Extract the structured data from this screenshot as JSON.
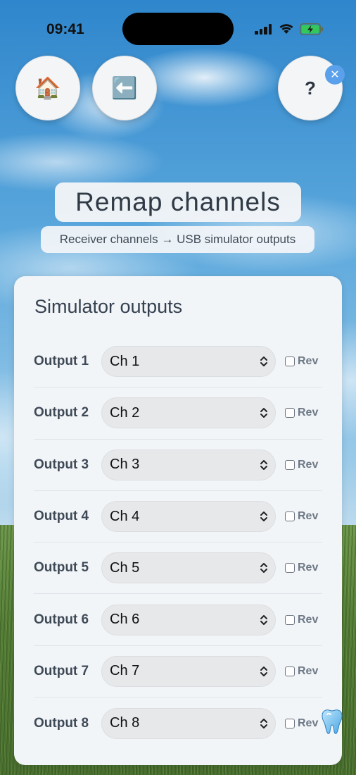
{
  "status_bar": {
    "time": "09:41"
  },
  "nav": {
    "home_icon": "🏠",
    "back_icon": "⬅️",
    "help_label": "?",
    "close_label": "✕"
  },
  "header": {
    "title": "Remap channels",
    "subtitle": "Receiver channels → USB simulator outputs"
  },
  "card": {
    "title": "Simulator outputs",
    "rev_label": "Rev",
    "rows": [
      {
        "label": "Output 1",
        "channel": "Ch 1",
        "reversed": false
      },
      {
        "label": "Output 2",
        "channel": "Ch 2",
        "reversed": false
      },
      {
        "label": "Output 3",
        "channel": "Ch 3",
        "reversed": false
      },
      {
        "label": "Output 4",
        "channel": "Ch 4",
        "reversed": false
      },
      {
        "label": "Output 5",
        "channel": "Ch 5",
        "reversed": false
      },
      {
        "label": "Output 6",
        "channel": "Ch 6",
        "reversed": false
      },
      {
        "label": "Output 7",
        "channel": "Ch 7",
        "reversed": false
      },
      {
        "label": "Output 8",
        "channel": "Ch 8",
        "reversed": false
      }
    ]
  },
  "colors": {
    "accent": "#5aa0ea",
    "card_bg": "#f2f5f8",
    "text_primary": "#35414f",
    "battery_fill": "#34c759"
  },
  "icons": [
    "home-icon",
    "back-arrow-icon",
    "help-icon",
    "close-icon",
    "tooth-icon",
    "chevron-updown-icon",
    "checkbox-icon"
  ]
}
